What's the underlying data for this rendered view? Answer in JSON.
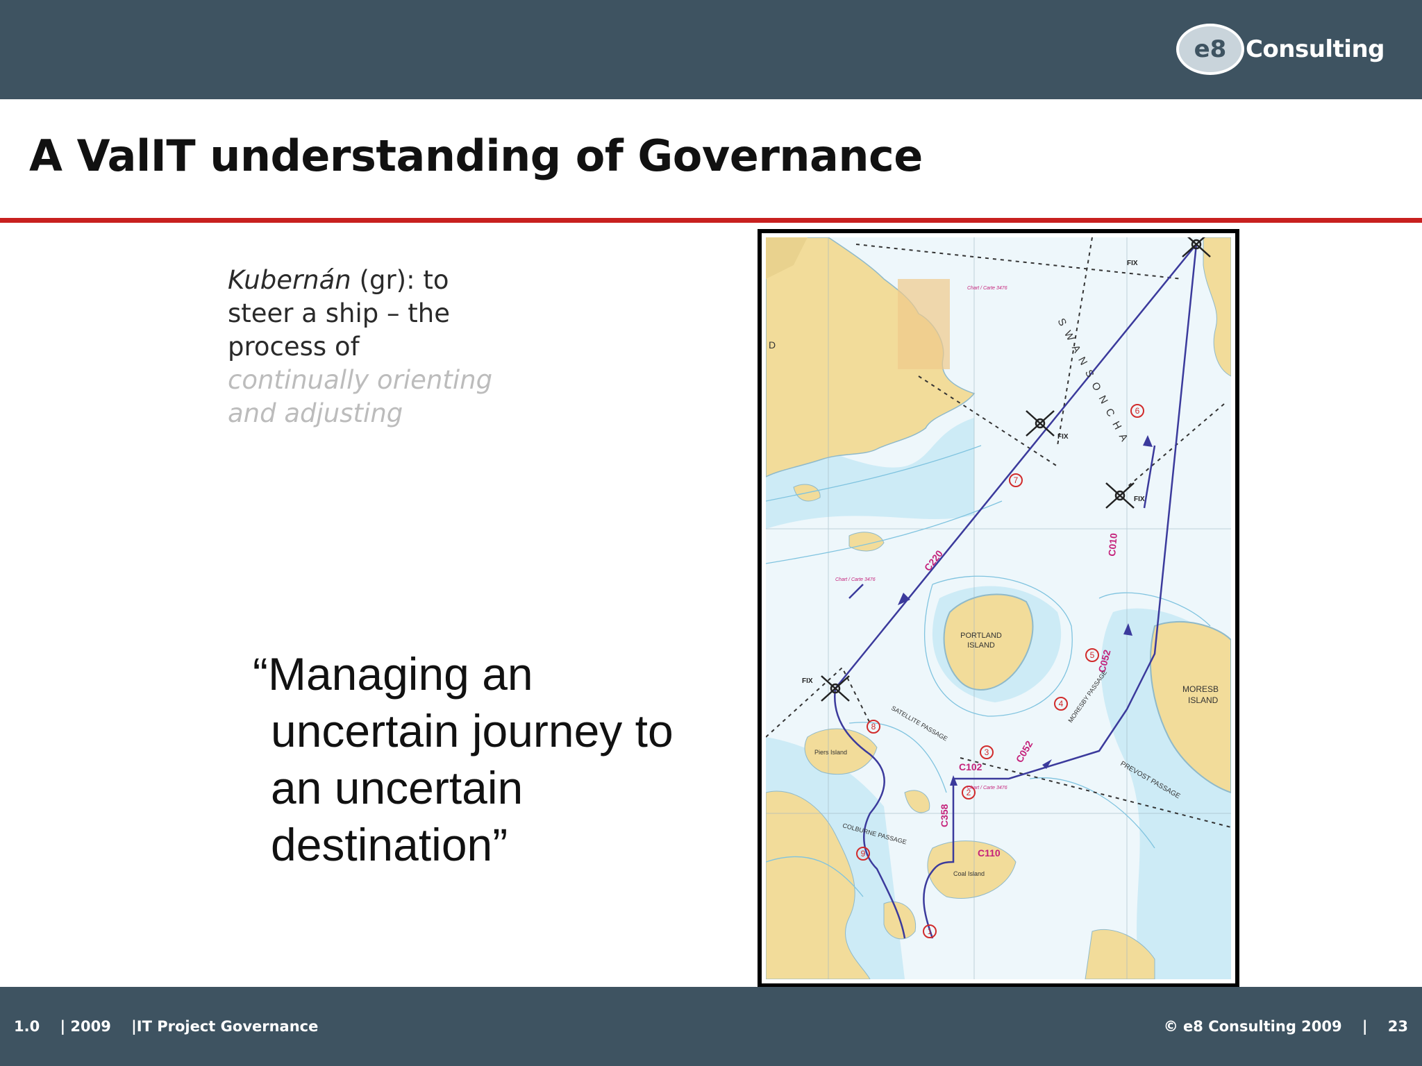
{
  "header": {
    "logo_mark": "e8",
    "logo_text": "Consulting"
  },
  "slide": {
    "title": "A ValIT understanding of Governance",
    "definition": {
      "term": "Kubernán",
      "rest": " (gr): to steer a ship – the process of ",
      "faded": "continually orienting and adjusting"
    },
    "quote_lines": [
      "“Managing an",
      "uncertain journey to",
      "an uncertain",
      "destination”"
    ]
  },
  "map": {
    "labels": {
      "fix": "FIX",
      "portland": "PORTLAND",
      "island": "ISLAND",
      "moresby1": "MORESB",
      "moresby2": "ISLAND",
      "swanson": "S W A N S O N   C H A",
      "c220": "C220",
      "c010": "C010",
      "c052a": "C052",
      "c052b": "C052",
      "c102": "C102",
      "c110": "C110",
      "c358": "C358",
      "piers": "Piers Island",
      "coal": "Coal Island",
      "satellite": "SATELLITE PASSAGE",
      "colburne": "COLBURNE PASSAGE",
      "moresby_passage": "MORESBY PASSAGE",
      "prevost": "PREVOST PASSAGE",
      "chart1": "Chart / Carte 3476",
      "chart2": "Chart / Carte 3476",
      "chart3": "Chart / Carte 3476",
      "waypoints": [
        "1",
        "2",
        "3",
        "4",
        "5",
        "6",
        "7",
        "8",
        "9"
      ],
      "d": "D"
    }
  },
  "footer": {
    "left": "1.0    | 2009    |IT Project Governance",
    "right": "© e8 Consulting 2009    |    23"
  },
  "colors": {
    "header": "#3e5361",
    "accent_line": "#c8201f",
    "route": "#3b3a9c",
    "waypoint": "#d12b2b",
    "land": "#f2dc9a",
    "water_shallow": "#b9e3f3"
  }
}
